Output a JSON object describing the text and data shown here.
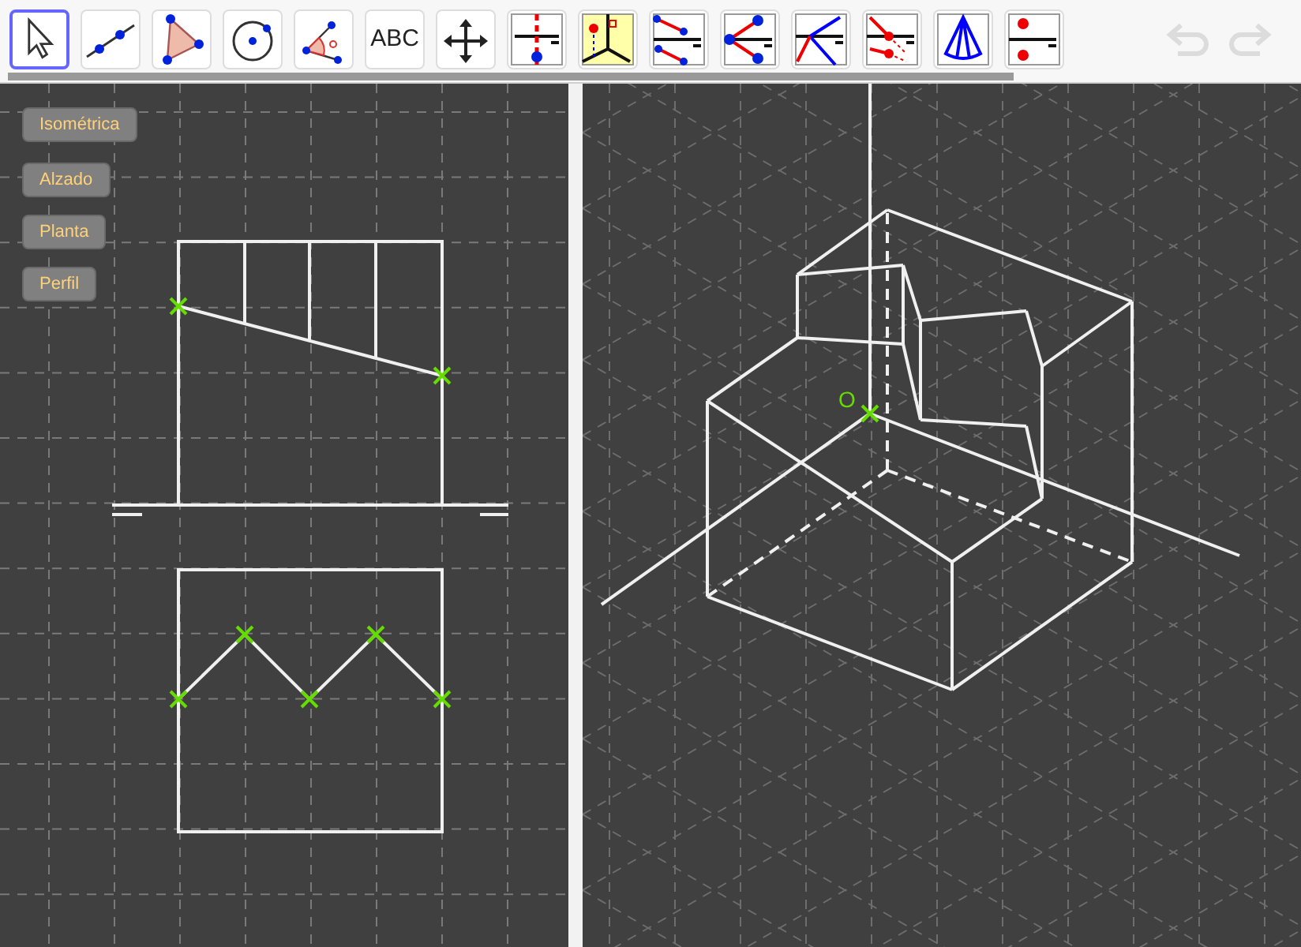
{
  "toolbar": {
    "tools": [
      {
        "kind": "pointer",
        "selected": true
      },
      {
        "kind": "line",
        "selected": false
      },
      {
        "kind": "polygon",
        "selected": false
      },
      {
        "kind": "circle",
        "selected": false
      },
      {
        "kind": "angle",
        "selected": false
      },
      {
        "kind": "text",
        "label": "ABC",
        "selected": false
      },
      {
        "kind": "move",
        "selected": false
      },
      {
        "kind": "dihedral1",
        "selected": false
      },
      {
        "kind": "dihedral3d",
        "selected": false
      },
      {
        "kind": "segments",
        "selected": false
      },
      {
        "kind": "fan",
        "selected": false
      },
      {
        "kind": "cross",
        "selected": false
      },
      {
        "kind": "projection",
        "selected": false
      },
      {
        "kind": "cone",
        "selected": false
      },
      {
        "kind": "points",
        "selected": false
      }
    ]
  },
  "left_view": {
    "buttons": [
      "Isométrica",
      "Alzado",
      "Planta",
      "Perfil"
    ]
  },
  "right_view": {
    "origin_label": "O"
  }
}
